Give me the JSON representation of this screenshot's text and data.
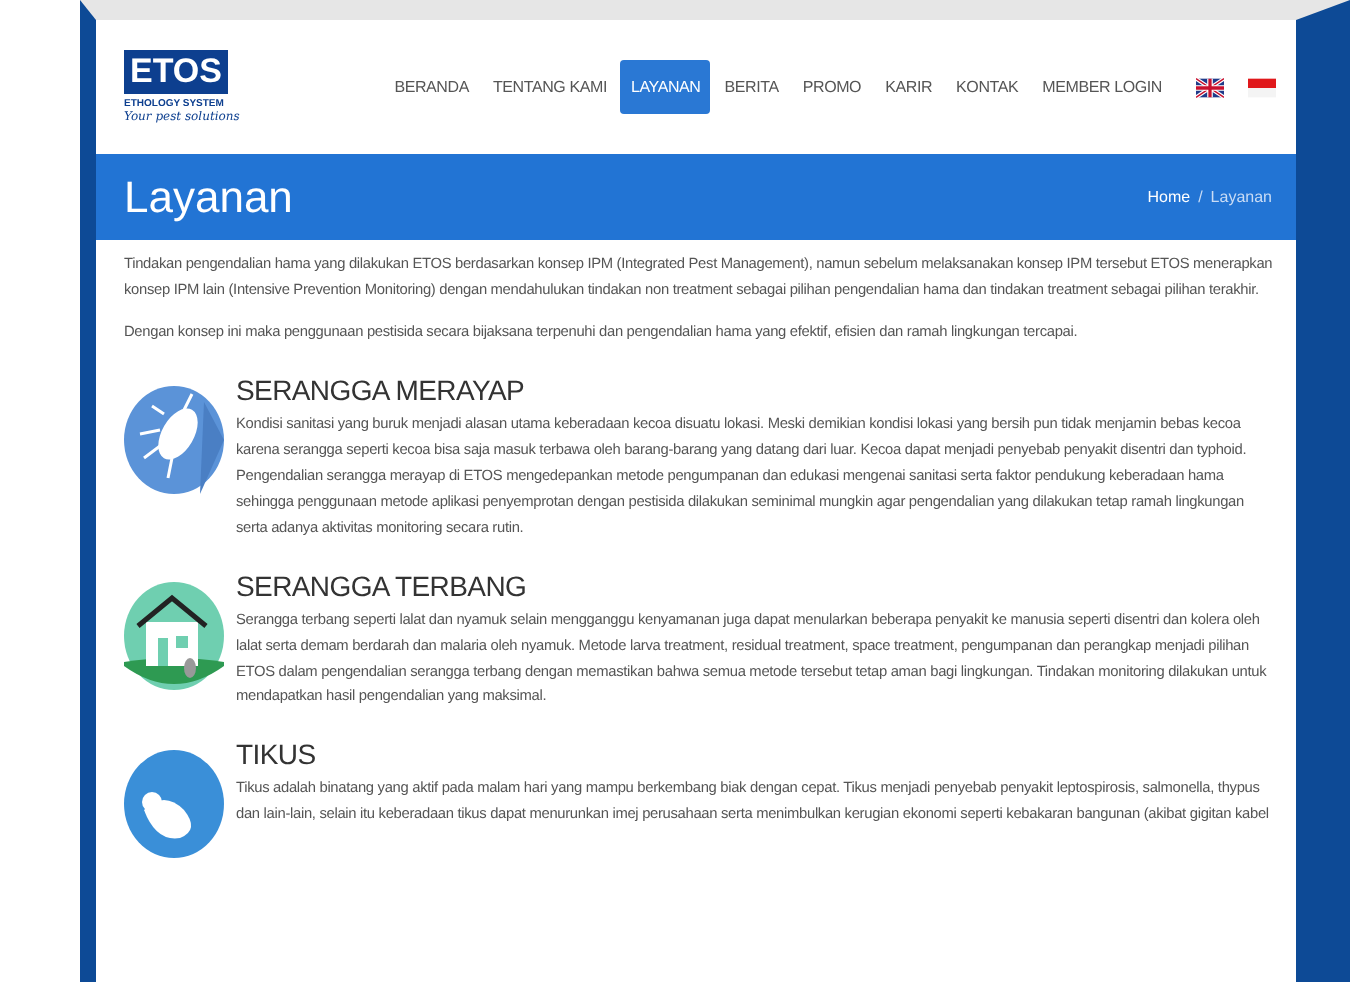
{
  "logo": {
    "name": "ETOS",
    "subtitle": "ETHOLOGY SYSTEM",
    "tagline": "Your pest solutions"
  },
  "nav": [
    {
      "label": "BERANDA",
      "selected": false
    },
    {
      "label": "TENTANG KAMI",
      "selected": false
    },
    {
      "label": "LAYANAN",
      "selected": true
    },
    {
      "label": "BERITA",
      "selected": false
    },
    {
      "label": "PROMO",
      "selected": false
    },
    {
      "label": "KARIR",
      "selected": false
    },
    {
      "label": "KONTAK",
      "selected": false
    },
    {
      "label": "MEMBER LOGIN",
      "selected": false
    }
  ],
  "languages": [
    {
      "kind": "uk"
    },
    {
      "kind": "id"
    }
  ],
  "banner": {
    "title": "Layanan",
    "breadcrumb": [
      "Home",
      "Layanan"
    ],
    "separator": "/"
  },
  "intro": [
    "Tindakan pengendalian hama yang dilakukan ETOS berdasarkan konsep IPM (Integrated Pest Management), namun sebelum melaksanakan konsep IPM tersebut ETOS menerapkan konsep IPM lain (Intensive Prevention Monitoring) dengan mendahulukan tindakan non treatment sebagai pilihan pengendalian hama dan tindakan treatment sebagai pilihan terakhir.",
    "Dengan konsep ini maka penggunaan pestisida secara bijaksana terpenuhi dan pengendalian hama yang efektif, efisien dan ramah lingkungan tercapai."
  ],
  "services": [
    {
      "kind": "cockroach",
      "title": "SERANGGA MERAYAP",
      "text": "Kondisi sanitasi yang buruk menjadi alasan utama keberadaan kecoa disuatu lokasi. Meski demikian kondisi lokasi yang bersih pun tidak menjamin bebas kecoa karena serangga seperti kecoa bisa saja masuk terbawa oleh barang-barang yang datang dari luar. Kecoa dapat menjadi penyebab penyakit disentri dan typhoid. Pengendalian serangga merayap di ETOS mengedepankan metode pengumpanan dan edukasi mengenai sanitasi serta faktor pendukung keberadaan hama sehingga penggunaan metode aplikasi penyemprotan dengan pestisida dilakukan seminimal mungkin agar pengendalian yang dilakukan tetap ramah lingkungan serta adanya aktivitas monitoring secara rutin."
    },
    {
      "kind": "house",
      "title": "SERANGGA TERBANG",
      "text": "Serangga terbang seperti lalat dan nyamuk selain mengganggu kenyamanan juga dapat menularkan beberapa penyakit ke manusia seperti disentri dan kolera oleh lalat serta demam berdarah dan malaria oleh nyamuk. Metode larva treatment, residual treatment, space treatment, pengumpanan dan perangkap menjadi pilihan ETOS dalam pengendalian serangga terbang dengan memastikan bahwa semua metode tersebut tetap aman bagi lingkungan. Tindakan monitoring dilakukan untuk mendapatkan hasil pengendalian yang maksimal."
    },
    {
      "kind": "rat",
      "title": "TIKUS",
      "text": "Tikus adalah binatang yang aktif pada malam hari yang mampu berkembang biak dengan cepat. Tikus menjadi penyebab penyakit leptospirosis, salmonella, thypus dan lain-lain, selain itu keberadaan tikus dapat menurunkan imej perusahaan serta menimbulkan kerugian ekonomi seperti kebakaran bangunan (akibat gigitan kabel"
    }
  ]
}
